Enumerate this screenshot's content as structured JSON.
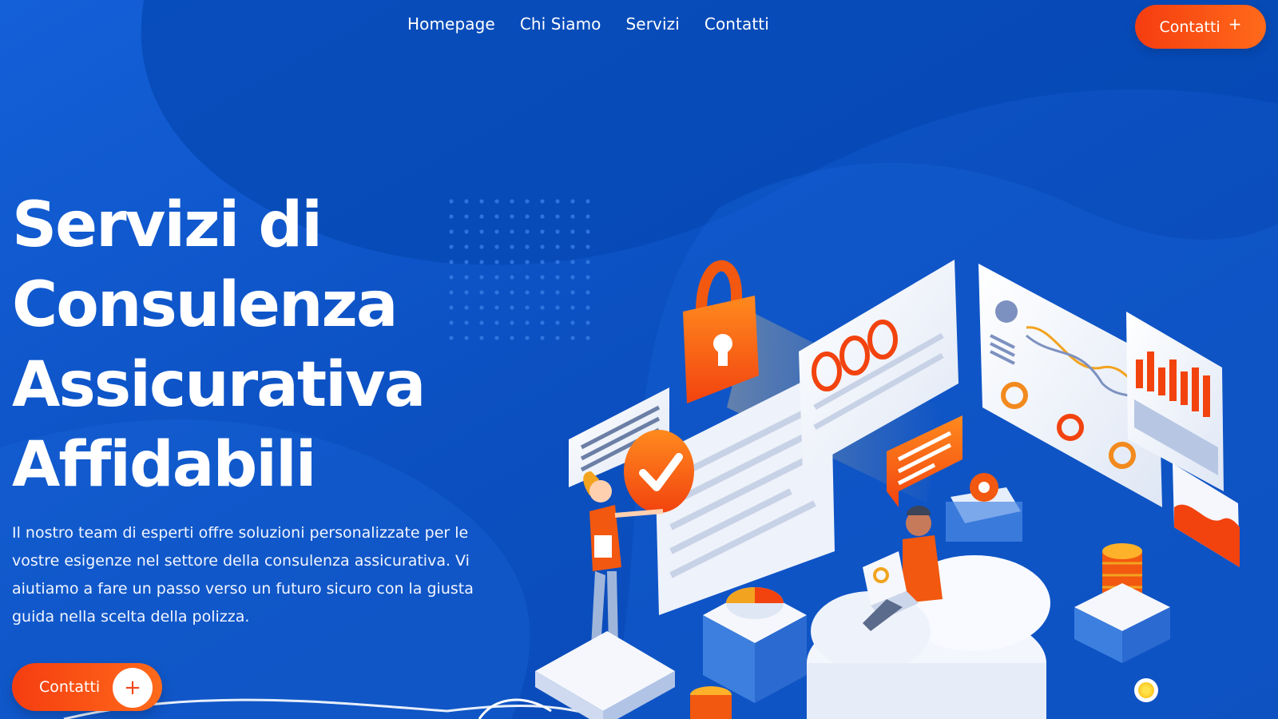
{
  "nav": {
    "items": [
      "Homepage",
      "Chi Siamo",
      "Servizi",
      "Contatti"
    ],
    "cta_label": "Contatti",
    "cta_icon": "plus-icon"
  },
  "hero": {
    "title_lines": [
      "Servizi di",
      "Consulenza",
      "Assicurativa",
      "Affidabili"
    ],
    "description": "Il nostro team di esperti offre soluzioni personalizzate per le vostre esigenze nel settore della consulenza assicurativa. Vi aiutiamo a fare un passo verso un futuro sicuro con la giusta guida nella scelta della polizza.",
    "cta_label": "Contatti",
    "cta_icon": "plus-icon"
  },
  "colors": {
    "background": "#0b4fc0",
    "accent": "#f53d10",
    "accent_light": "#ff6a1a"
  }
}
